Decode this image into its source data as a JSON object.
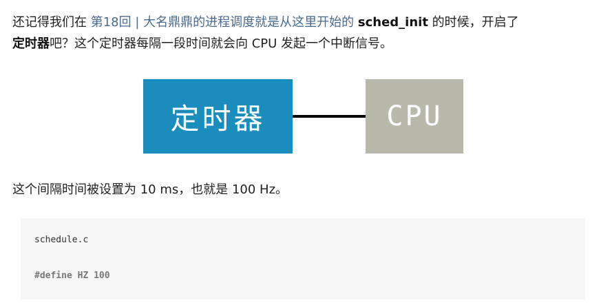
{
  "paragraph1": {
    "prefix": "还记得我们在 ",
    "link_text": "第18回 | 大名鼎鼎的进程调度就是从这里开始的",
    "middle": " ",
    "bold_func": "sched_init",
    "suffix": " 的时候，开启了"
  },
  "paragraph2": {
    "bold_term": "定时器",
    "suffix": "吧？这个定时器每隔一段时间就会向 CPU 发起一个中断信号。"
  },
  "diagram": {
    "timer_label": "定时器",
    "cpu_label": "CPU",
    "colors": {
      "timer_box": "#1b8dbd",
      "cpu_box": "#b8b9aa",
      "connector": "#000000"
    }
  },
  "paragraph3": {
    "text": "这个间隔时间被设置为 10 ms，也就是 100 Hz。"
  },
  "code": {
    "filename": "schedule.c",
    "line1": "#define HZ 100"
  }
}
